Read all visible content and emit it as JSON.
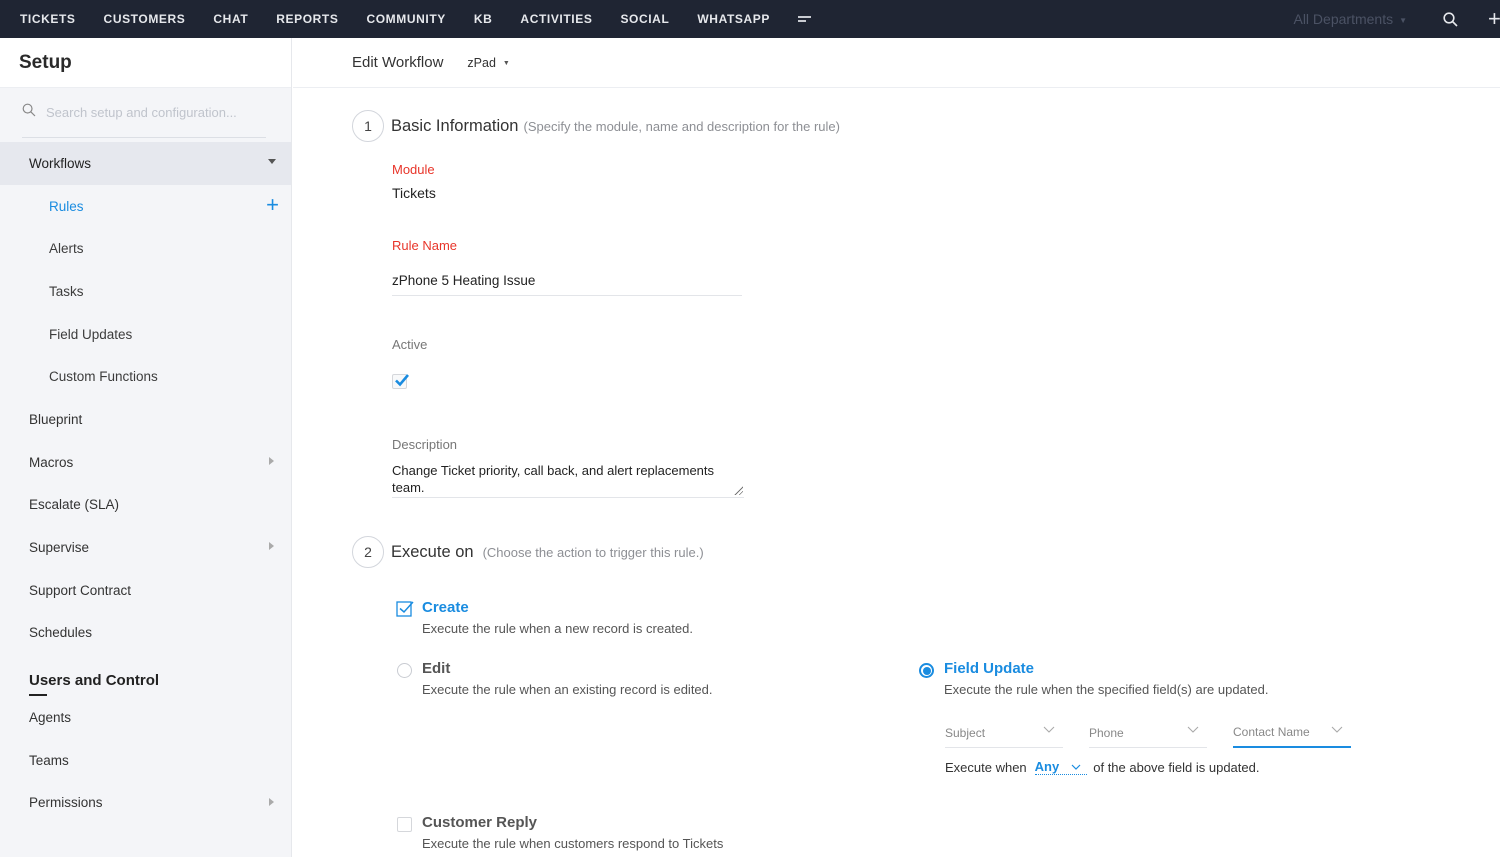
{
  "topnav": {
    "items": [
      "TICKETS",
      "CUSTOMERS",
      "CHAT",
      "REPORTS",
      "COMMUNITY",
      "KB",
      "ACTIVITIES",
      "SOCIAL",
      "WHATSAPP"
    ],
    "more_icon": "hamburger-more-icon",
    "department": "All Departments",
    "search_icon": "search-icon",
    "add_icon": "plus-icon"
  },
  "sidebar": {
    "title": "Setup",
    "search_placeholder": "Search setup and configuration...",
    "items": [
      {
        "label": "Workflows",
        "type": "group",
        "expanded": true
      },
      {
        "label": "Rules",
        "type": "sub",
        "selected": true,
        "add": true
      },
      {
        "label": "Alerts",
        "type": "sub"
      },
      {
        "label": "Tasks",
        "type": "sub"
      },
      {
        "label": "Field Updates",
        "type": "sub"
      },
      {
        "label": "Custom Functions",
        "type": "sub"
      },
      {
        "label": "Blueprint",
        "type": "item"
      },
      {
        "label": "Macros",
        "type": "item",
        "submenu": true
      },
      {
        "label": "Escalate (SLA)",
        "type": "item"
      },
      {
        "label": "Supervise",
        "type": "item",
        "submenu": true
      },
      {
        "label": "Support Contract",
        "type": "item"
      },
      {
        "label": "Schedules",
        "type": "item"
      }
    ],
    "section2": {
      "title": "Users and Control",
      "items": [
        {
          "label": "Agents"
        },
        {
          "label": "Teams"
        },
        {
          "label": "Permissions",
          "submenu": true
        }
      ]
    }
  },
  "main": {
    "title": "Edit Workflow",
    "department": "zPad",
    "step1": {
      "num": "1",
      "title": "Basic Information",
      "hint": "(Specify the module, name and description for the rule)",
      "module_label": "Module",
      "module_value": "Tickets",
      "rule_name_label": "Rule Name",
      "rule_name_value": "zPhone 5 Heating Issue",
      "active_label": "Active",
      "active_checked": true,
      "description_label": "Description",
      "description_value": "Change Ticket priority, call back, and alert replacements team."
    },
    "step2": {
      "num": "2",
      "title": "Execute on",
      "hint": "(Choose the action to trigger this rule.)",
      "options": [
        {
          "title": "Create",
          "desc": "Execute the rule when a new record is created.",
          "checked": true
        },
        {
          "title": "Edit",
          "desc": "Execute the rule when an existing record is edited.",
          "checked": false
        },
        {
          "title": "Field Update",
          "desc": "Execute the rule when the specified field(s) are updated.",
          "checked": true
        },
        {
          "title": "Customer Reply",
          "desc": "Execute the rule when customers respond to Tickets",
          "checked": false
        }
      ],
      "fields": [
        "Subject",
        "Phone",
        "Contact Name"
      ],
      "execute_when_prefix": "Execute when",
      "execute_when_value": "Any",
      "execute_when_suffix": "of the above field is updated."
    }
  },
  "colors": {
    "topbar": "#1f2533",
    "accent": "#1a8ce0",
    "required": "#e8352a",
    "sidebar_bg": "#f4f5f8"
  }
}
